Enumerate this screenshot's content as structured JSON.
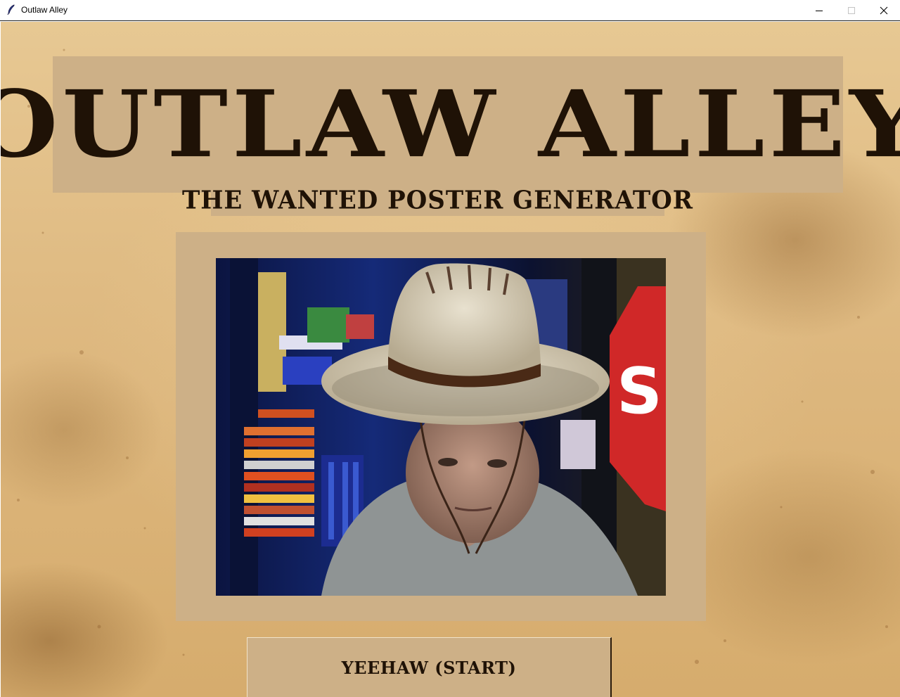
{
  "window": {
    "title": "Outlaw Alley",
    "icon": "feather-icon",
    "controls": [
      "minimize-icon",
      "maximize-icon",
      "close-icon"
    ]
  },
  "banner": {
    "title": "OUTLAW ALLEY",
    "subtitle": "THE WANTED POSTER GENERATOR"
  },
  "camera": {
    "description_icon": "webcam-feed"
  },
  "start_button": {
    "label": "YEEHAW (START)"
  },
  "colors": {
    "parchment": "#ddb77e",
    "panel": "#cdb087",
    "ink": "#1f1206"
  }
}
